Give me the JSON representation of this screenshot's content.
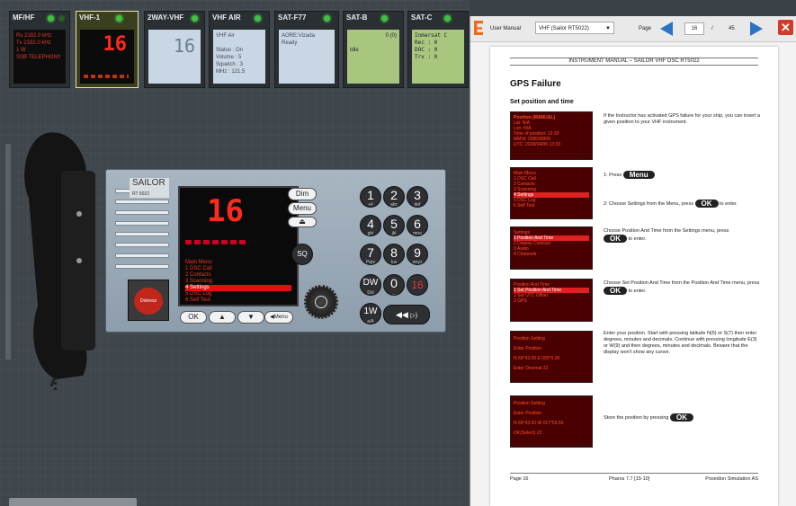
{
  "tabs": [
    {
      "title": "MF/HF",
      "screen": [
        "Rx 2182.0 kHz",
        "Tx 2182.0 kHz",
        "1 W",
        "SSB TELEPHONY"
      ]
    },
    {
      "title": "VHF-1",
      "screen": [
        "16"
      ]
    },
    {
      "title": "2WAY-VHF",
      "screen": [
        "16"
      ]
    },
    {
      "title": "VHF AIR",
      "screen": [
        "VHF Air",
        "",
        "Status : On",
        "Volume : 5",
        "Squelch : 3",
        "MHz : 121.5"
      ]
    },
    {
      "title": "SAT-F77",
      "screen": [
        "AORE:Vizada",
        "Ready"
      ]
    },
    {
      "title": "SAT-B",
      "screen": [
        "0 (0)",
        "",
        "Idle"
      ]
    },
    {
      "title": "SAT-C",
      "screen": [
        "Inmarsat C",
        "Rec : 0",
        "DOC : 0",
        "Trx : 0"
      ]
    }
  ],
  "radio": {
    "brand": "SAILOR",
    "model": "RT 5022",
    "channel": "16",
    "menu": [
      "Main Menu",
      "1 DSC Call",
      "2 Contacts",
      "3 Scanning",
      "4 Settings",
      "5 DSC Log",
      "6 Self Test"
    ],
    "buttons": {
      "dim": "Dim",
      "menu": "Menu",
      "sq": "SQ",
      "ok": "OK",
      "menu2": "Menu",
      "dw": "DW",
      "dw_sub": "Dsl",
      "one_w": "1W",
      "one_w_sub": "a/A",
      "ch16": "16",
      "distress": "Distress"
    },
    "keys": [
      [
        "1",
        "+#"
      ],
      [
        "2",
        "abc"
      ],
      [
        "3",
        "def"
      ],
      [
        "4",
        "ghi"
      ],
      [
        "5",
        "jkl"
      ],
      [
        "6",
        "mno"
      ],
      [
        "7",
        "Pqrs"
      ],
      [
        "8",
        "tuv"
      ],
      [
        "9",
        "wxyz"
      ],
      [
        "0",
        "_"
      ]
    ]
  },
  "viewer": {
    "doc_label": "User Manual",
    "doc_select": "VHF (Sailor RT5022)",
    "page_label": "Page",
    "page_current": "16",
    "page_sep": "/",
    "page_total": "45"
  },
  "page": {
    "header": "INSTRUMENT MANUAL – SAILOR VHF DSC RT5022",
    "title": "GPS Failure",
    "subtitle": "Set position and time",
    "steps": [
      {
        "screen": [
          "Position (MANUAL)",
          "Lat: N/A",
          "Lon: N/A",
          "Time of position: 13:33",
          "MMSI: 258590000",
          "UTC: 2018/04/06 13:33"
        ],
        "text": "If the Instructor has activated GPS failure for your ship, you can insert a given position to your VHF instrument."
      },
      {
        "screen": [
          "Main Menu",
          "1 DSC Call",
          "2 Contacts",
          "3 Scanning",
          "4 Settings",
          "5 DSC Log",
          "6 Self Test"
        ],
        "text1": "1: Press",
        "btn1": "Menu",
        "text2": "2: Choose Settings from the Menu, press",
        "btn2": "OK",
        "text3": "to enter."
      },
      {
        "screen": [
          "Settings",
          "1 Position And Time",
          "2 Display Contrast",
          "3 Audio",
          "4 Channels"
        ],
        "text1": "Choose Position And Time from the Settings menu, press",
        "btn": "OK",
        "text2": "to enter."
      },
      {
        "screen": [
          "Position And Time",
          "1 Set Position And Time",
          "2 Set UTC Offset",
          "3 GPS"
        ],
        "text1": "Choose Set Position And Time from the Position And Time menu, press",
        "btn": "OK",
        "text2": "to enter."
      },
      {
        "screen": [
          "Position Setting",
          "Enter Position",
          "N 69°43.00 E 000°0.00",
          "Enter Decimal  22"
        ],
        "text": "Enter your position. Start with pressing latitude N(6) or S(7) then enter degrees, minutes and decimals. Continue with pressing longitude E(3) or W(9) and then degrees, minutes and decimals. Beware that the display won't show any cursor."
      },
      {
        "screen": [
          "Position Setting",
          "Enter Position",
          "N 69°43.00 W 017°55.55",
          "OK(Select)  22"
        ],
        "text1": "Store the position by pressing",
        "btn": "OK"
      }
    ],
    "footer_left": "Page 16",
    "footer_mid": "Pharos 7.7 [15-10]",
    "footer_right": "Poseidon Simulation AS"
  },
  "colors": {
    "screen_red": "#ff2a1c",
    "panel": "#9aaab7",
    "led_green": "#3ec13e"
  }
}
